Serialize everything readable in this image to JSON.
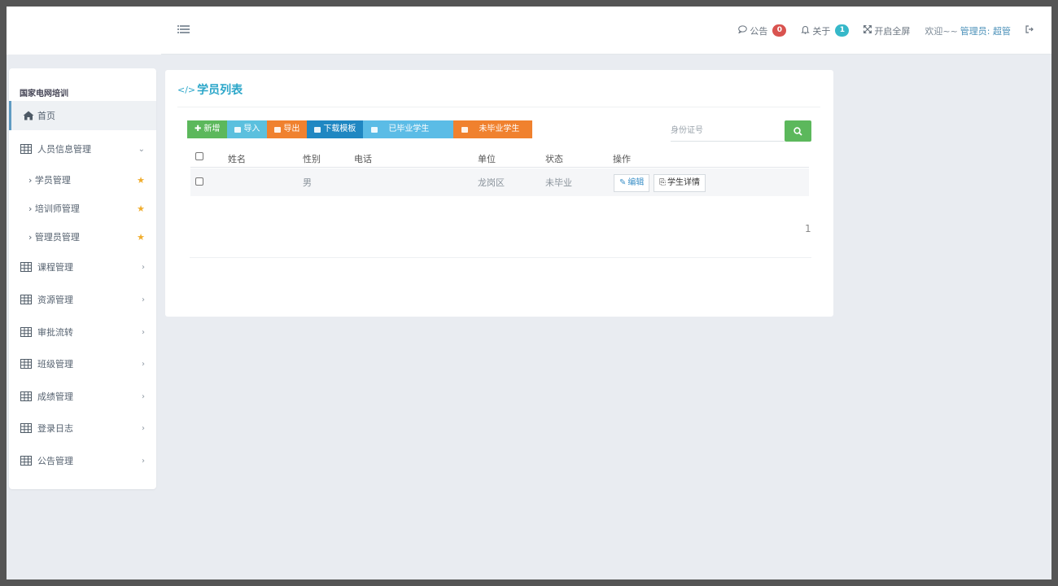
{
  "header": {
    "notice_label": "公告",
    "notice_count": "0",
    "notice_badge_color": "#d9534f",
    "about_label": "关于",
    "about_count": "1",
    "about_badge_color": "#36b8c9",
    "fullscreen_label": "开启全屏",
    "welcome_prefix": "欢迎~~",
    "welcome_user": "管理员: 超管",
    "icons": [
      "menu-toggle-icon",
      "comment-icon",
      "bell-icon",
      "fullscreen-icon",
      "logout-icon"
    ]
  },
  "sidebar": {
    "title": "国家电网培训",
    "items": [
      {
        "label": "首页",
        "icon": "home-icon",
        "active": true
      },
      {
        "label": "人员信息管理",
        "icon": "table-icon",
        "expanded": true,
        "children": [
          {
            "label": "学员管理"
          },
          {
            "label": "培训师管理"
          },
          {
            "label": "管理员管理"
          }
        ]
      },
      {
        "label": "课程管理",
        "icon": "table-icon"
      },
      {
        "label": "资源管理",
        "icon": "table-icon"
      },
      {
        "label": "审批流转",
        "icon": "table-icon"
      },
      {
        "label": "班级管理",
        "icon": "table-icon"
      },
      {
        "label": "成绩管理",
        "icon": "table-icon"
      },
      {
        "label": "登录日志",
        "icon": "table-icon"
      },
      {
        "label": "公告管理",
        "icon": "table-icon"
      }
    ]
  },
  "main": {
    "title": "学员列表",
    "toolbar": {
      "add": "新增",
      "import": "导入",
      "export": "导出",
      "download_template": "下载模板",
      "graduated": "已毕业学生",
      "not_graduated": "未毕业学生"
    },
    "search": {
      "placeholder": "身份证号",
      "value": ""
    },
    "table": {
      "columns": [
        "姓名",
        "性别",
        "电话",
        "单位",
        "状态",
        "操作"
      ],
      "rows": [
        {
          "name": "",
          "gender": "男",
          "phone": "",
          "unit": "龙岗区",
          "status": "未毕业",
          "actions": [
            "编辑",
            "学生详情"
          ]
        }
      ]
    },
    "pagination": {
      "current": "1"
    }
  }
}
